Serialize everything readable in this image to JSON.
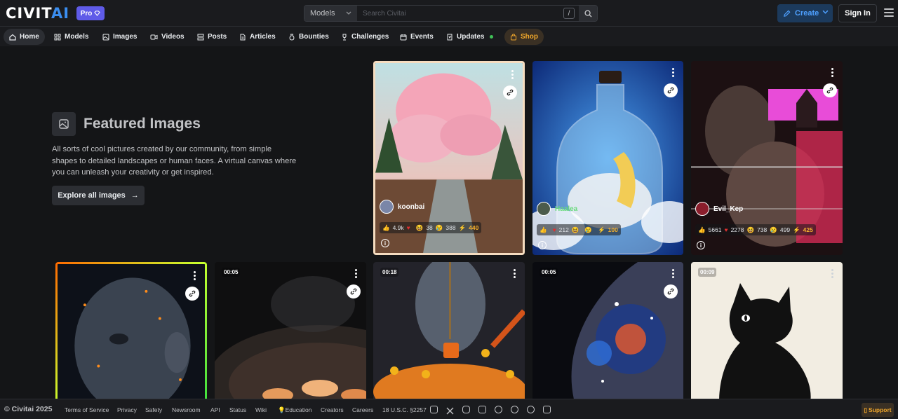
{
  "header": {
    "logo_part1": "CIVIT",
    "logo_part2": "AI",
    "pro_label": "Pro",
    "search_category": "Models",
    "search_placeholder": "Search Civitai",
    "search_shortcut": "/",
    "create_label": "Create",
    "signin_label": "Sign In"
  },
  "nav": {
    "items": [
      {
        "label": "Home",
        "icon": "home-icon"
      },
      {
        "label": "Models",
        "icon": "grid-icon"
      },
      {
        "label": "Images",
        "icon": "photo-icon"
      },
      {
        "label": "Videos",
        "icon": "video-icon"
      },
      {
        "label": "Posts",
        "icon": "posts-icon"
      },
      {
        "label": "Articles",
        "icon": "article-icon"
      },
      {
        "label": "Bounties",
        "icon": "moneybag-icon"
      },
      {
        "label": "Challenges",
        "icon": "trophy-icon"
      },
      {
        "label": "Events",
        "icon": "calendar-icon"
      },
      {
        "label": "Updates",
        "icon": "updates-icon"
      },
      {
        "label": "Shop",
        "icon": "shopping-bag-icon"
      }
    ]
  },
  "featured": {
    "title": "Featured Images",
    "description": "All sorts of cool pictures created by our community, from simple shapes to detailed landscapes or human faces. A virtual canvas where you can unleash your creativity or get inspired.",
    "explore_label": "Explore all images",
    "explore_arrow": "→"
  },
  "cards": [
    {
      "username": "koonbai",
      "likes": "4.9k",
      "hearts": "",
      "laughs": "38",
      "cries": "388",
      "buzz": "440",
      "duration": ""
    },
    {
      "username": "Haalea",
      "likes": "",
      "hearts": "212",
      "laughs": "",
      "cries": "",
      "buzz": "100",
      "duration": ""
    },
    {
      "username": "Evil_Kep",
      "likes": "5661",
      "hearts": "2278",
      "laughs": "738",
      "cries": "499",
      "buzz": "425",
      "duration": ""
    },
    {
      "duration": ""
    },
    {
      "duration": "00:05"
    },
    {
      "duration": "00:18"
    },
    {
      "duration": "00:05"
    },
    {
      "duration": "00:09"
    }
  ],
  "footer": {
    "copyright": "© Civitai 2025",
    "links": [
      "Terms of Service",
      "Privacy",
      "Safety",
      "Newsroom",
      "API",
      "Status",
      "Wiki",
      "Education",
      "Creators",
      "Careers",
      "18 U.S.C. §2257"
    ],
    "social_icons": [
      "discord-icon",
      "x-icon",
      "instagram-icon",
      "youtube-icon",
      "tiktok-icon",
      "reddit-icon",
      "github-icon",
      "twitch-icon"
    ],
    "support_label": "Support"
  },
  "colors": {
    "accent_blue": "#3b8ef0",
    "pro_purple": "#5f5be8",
    "shop_orange": "#f0a72b",
    "online_green": "#40c057"
  }
}
